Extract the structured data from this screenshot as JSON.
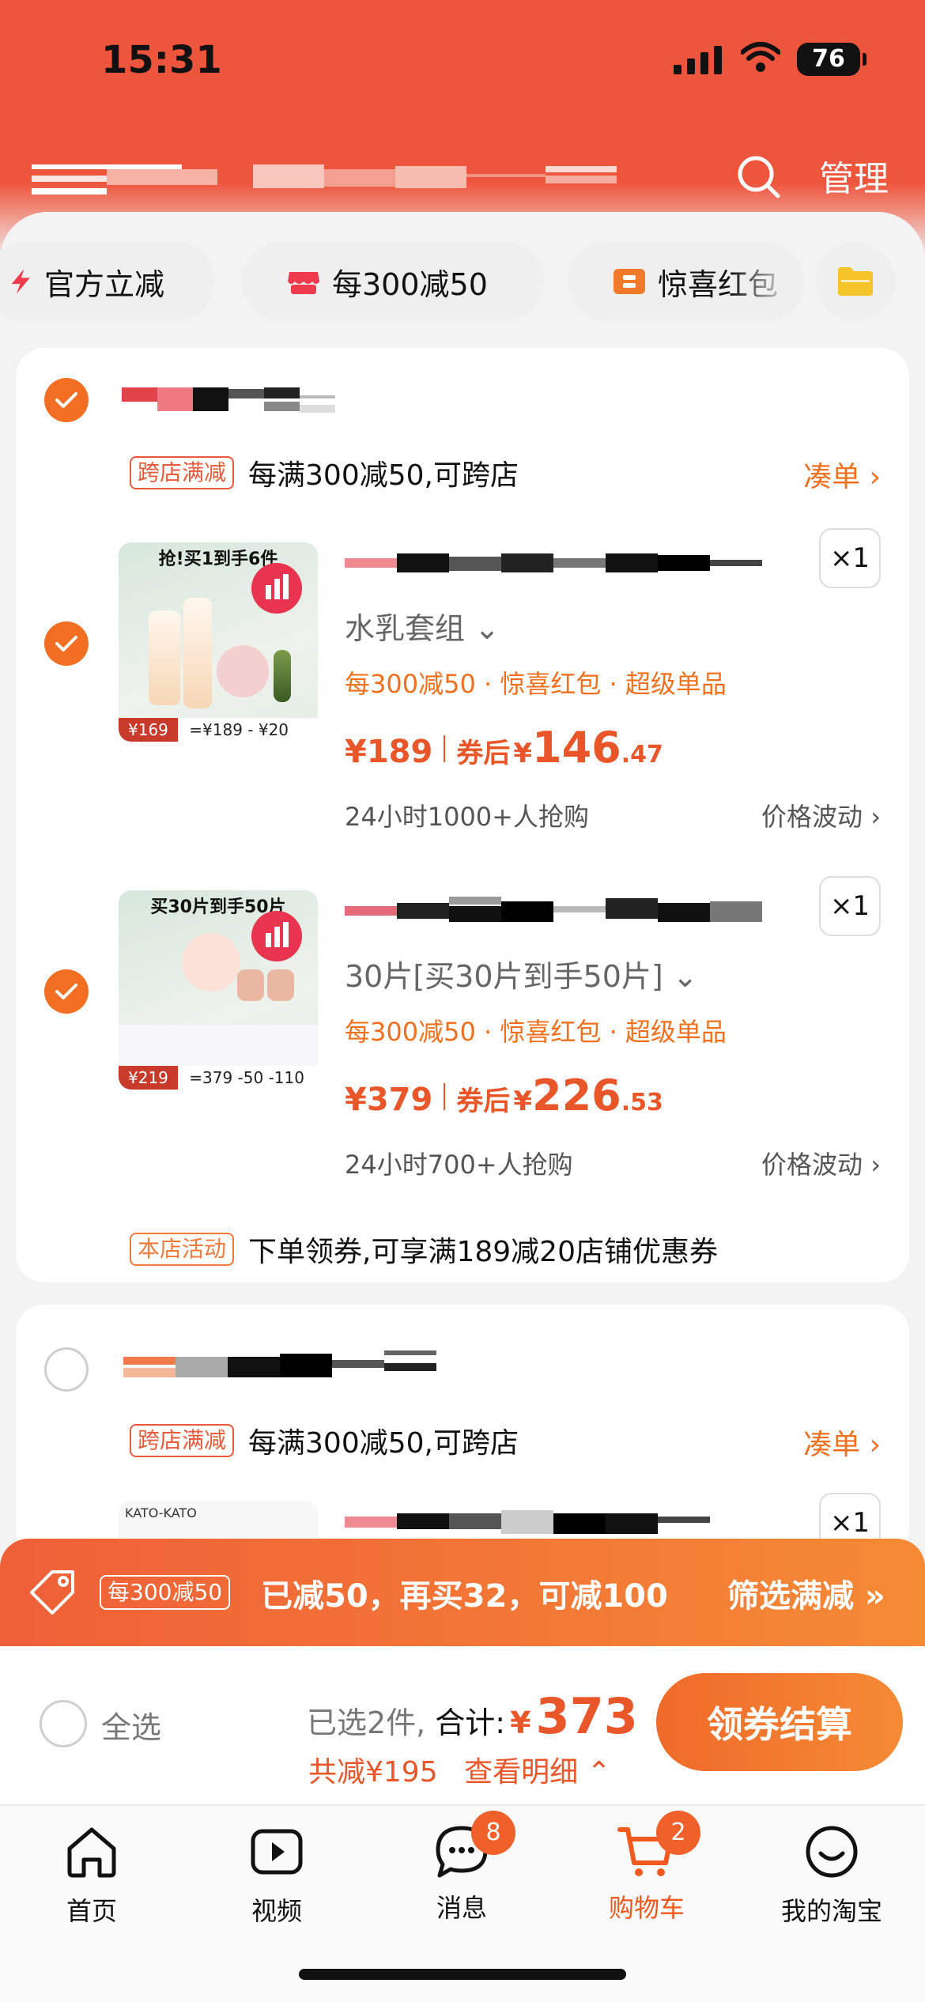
{
  "status_bar": {
    "time": "15:31",
    "battery": "76"
  },
  "header": {
    "manage_label": "管理",
    "colors": {
      "brand": "#ee553d"
    }
  },
  "chips": [
    {
      "label": "官方立减",
      "icon": "lightning-icon"
    },
    {
      "label": "每300减50",
      "icon": "store-awning-icon"
    },
    {
      "label": "惊喜红包",
      "icon": "red-envelope-icon"
    }
  ],
  "store1": {
    "promo_tag": "跨店满减",
    "promo_text": "每满300减50,可跨店",
    "link": "凑单 ›",
    "items": [
      {
        "thumb_banner": "抢!买1到手6件",
        "thumb_price_left": "¥169",
        "thumb_calc": "=¥189 - ¥20",
        "variant": "水乳套组 ⌄",
        "offers": "每300减50 · 惊喜红包 · 超级单品",
        "price": "¥189",
        "coupon_label": "券后",
        "coupon_yen": "¥",
        "coupon_int": "146",
        "coupon_dec": ".47",
        "sold": "24小时1000+人抢购",
        "fluct": "价格波动 ›",
        "qty": "×1"
      },
      {
        "thumb_banner": "买30片到手50片",
        "thumb_price_left": "¥219",
        "thumb_calc": "=379 -50 -110",
        "variant": "30片[买30片到手50片] ⌄",
        "offers": "每300减50 · 惊喜红包 · 超级单品",
        "price": "¥379",
        "coupon_label": "券后",
        "coupon_yen": "¥",
        "coupon_int": "226",
        "coupon_dec": ".53",
        "sold": "24小时700+人抢购",
        "fluct": "价格波动 ›",
        "qty": "×1"
      }
    ],
    "store_tag": "本店活动",
    "store_text": "下单领券,可享满189减20店铺优惠券"
  },
  "store2": {
    "promo_tag": "跨店满减",
    "promo_text": "每满300减50,可跨店",
    "link": "凑单 ›",
    "thumb_brand": "KATO-KATO",
    "qty": "×1"
  },
  "promo_banner": {
    "tag": "每300减50",
    "text": "已减50，再买32，可减100",
    "filter": "筛选满减 »"
  },
  "checkout": {
    "select_all": "全选",
    "selected": "已选2件,",
    "total_label": "合计:",
    "yen": "¥",
    "total": "373",
    "saved": "共减¥195",
    "detail": "查看明细 ⌃",
    "button": "领券结算"
  },
  "tabs": [
    {
      "label": "首页",
      "icon": "home-icon"
    },
    {
      "label": "视频",
      "icon": "video-icon"
    },
    {
      "label": "消息",
      "icon": "message-icon",
      "badge": "8"
    },
    {
      "label": "购物车",
      "icon": "cart-icon",
      "badge": "2",
      "active": true
    },
    {
      "label": "我的淘宝",
      "icon": "profile-icon"
    }
  ]
}
